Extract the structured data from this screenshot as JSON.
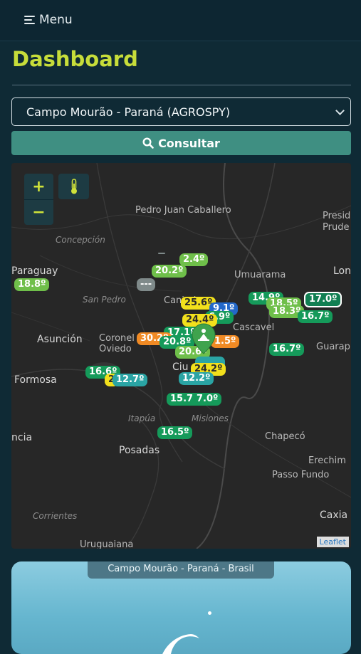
{
  "header": {
    "menu_label": "Menu"
  },
  "page": {
    "title": "Dashboard"
  },
  "station_select": {
    "value": "Campo Mourão - Paraná (AGROSPY)"
  },
  "search_button": {
    "label": "Consultar"
  },
  "map": {
    "zoom_in": "+",
    "zoom_out": "−",
    "attribution": "Leaflet",
    "places": [
      "Pedro Juan Caballero",
      "Concepción",
      "Paraguay",
      "San Pedro",
      "Caninde",
      "Umuarama",
      "Lon",
      "Presid Prude",
      "Asunción",
      "Coronel Oviedo",
      "Cascavel",
      "Guarap",
      "Formosa",
      "Ciu",
      "Itapúa",
      "Misiones",
      "Chapecó",
      "Erechim",
      "Passo Fundo",
      "Posadas",
      "ncia",
      "Corrientes",
      "Uruguaiana",
      "Caxia"
    ],
    "markers": [
      "20.2º",
      "2.4º",
      "18.8º",
      "---",
      "25.6º",
      "14.9º",
      "18.5º",
      "17.0º",
      "18.3º",
      "16.7º",
      "9.1º",
      "6.9º",
      "24.4º",
      "17.1º",
      "30.2º",
      "20.8º",
      "20.6º",
      "1.5º",
      "16.7º",
      "16.6º",
      "2",
      "12.7º",
      "24.2º",
      "12.2º",
      "15.7º",
      "7.0º",
      "16.5º"
    ]
  },
  "weather_card": {
    "location": "Campo Mourão - Paraná - Brasil"
  }
}
